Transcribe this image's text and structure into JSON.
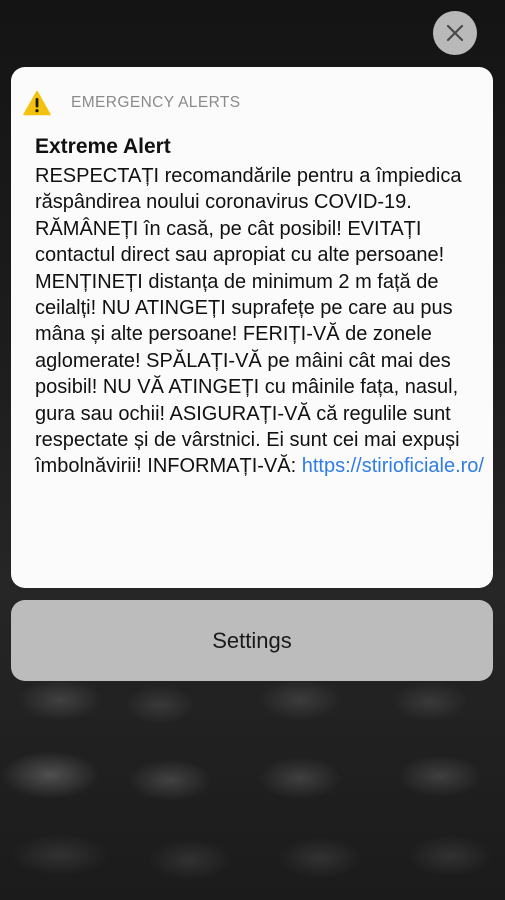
{
  "dismiss": {
    "icon": "close-icon"
  },
  "alert": {
    "app_name": "EMERGENCY ALERTS",
    "icon": "warning-icon",
    "icon_color": "#f4c20d",
    "title": "Extreme Alert",
    "body": "RESPECTAȚI recomandările pentru a împiedica răspândirea noului coronavirus COVID-19. RĂMÂNEȚI în casă, pe cât posibil! EVITAȚI contactul direct sau apropiat cu alte persoane! MENȚINEȚI distanța de minimum 2 m față de ceilalți! NU ATINGEȚI suprafețe pe care au pus mâna și alte persoane! FERIȚI-VĂ de zonele aglomerate! SPĂLAȚI-VĂ pe mâini cât mai des posibil! NU VĂ ATINGEȚI cu mâinile fața, nasul, gura sau ochii! ASIGURAȚI-VĂ că regulile sunt respectate și de vârstnici. Ei sunt cei mai expuși îmbolnăvirii! INFORMAȚI-VĂ: ",
    "link": "https://stirioficiale.ro/",
    "link_color": "#2f7de6"
  },
  "settings": {
    "label": "Settings"
  }
}
